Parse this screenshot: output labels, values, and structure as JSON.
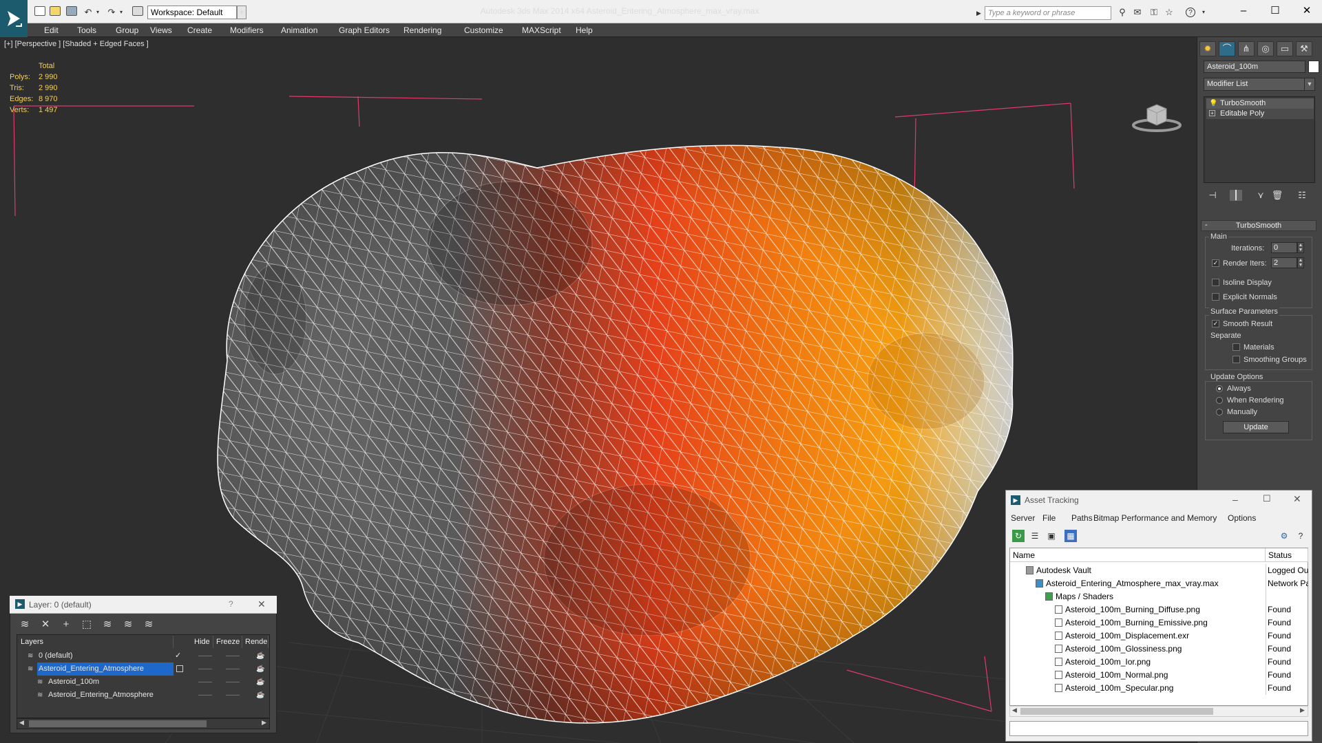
{
  "app": {
    "title": "Autodesk 3ds Max  2014 x64     Asteroid_Entering_Atmosphere_max_vray.max",
    "logo": "3ds-max-logo",
    "workspace_label": "Workspace: Default",
    "search_placeholder": "Type a keyword or phrase"
  },
  "menu": [
    "Edit",
    "Tools",
    "Group",
    "Views",
    "Create",
    "Modifiers",
    "Animation",
    "Graph Editors",
    "Rendering",
    "Customize",
    "MAXScript",
    "Help"
  ],
  "viewport": {
    "label": "[+] [Perspective ] [Shaded + Edged Faces ]",
    "stats": {
      "header": "Total",
      "rows": [
        {
          "label": "Polys:",
          "value": "2 990"
        },
        {
          "label": "Tris:",
          "value": "2 990"
        },
        {
          "label": "Edges:",
          "value": "8 970"
        },
        {
          "label": "Verts:",
          "value": "1 497"
        }
      ]
    },
    "colors": {
      "background": "#2e2e2e",
      "grid": "#3a3a3a",
      "bbox": "#e23a6b",
      "wire": "#ffffff"
    }
  },
  "command_panel": {
    "object_name": "Asteroid_100m",
    "modifier_list": "Modifier List",
    "stack": [
      "TurboSmooth",
      "Editable Poly"
    ],
    "rollout_title": "TurboSmooth",
    "main": {
      "title": "Main",
      "iterations_label": "Iterations:",
      "iterations_value": "0",
      "render_iters_label": "Render Iters:",
      "render_iters_value": "2",
      "render_iters_checked": true,
      "isoline_label": "Isoline Display",
      "explicit_label": "Explicit Normals"
    },
    "surface": {
      "title": "Surface Parameters",
      "smooth_label": "Smooth Result",
      "smooth_checked": true,
      "separate_label": "Separate",
      "materials_label": "Materials",
      "smoothing_label": "Smoothing Groups"
    },
    "update": {
      "title": "Update Options",
      "always": "Always",
      "when_rendering": "When Rendering",
      "manually": "Manually",
      "button": "Update"
    }
  },
  "layer_window": {
    "title": "Layer: 0 (default)",
    "help": "?",
    "close": "✕",
    "columns": [
      "Layers",
      "Hide",
      "Freeze",
      "Rende"
    ],
    "rows": [
      {
        "name": "0 (default)",
        "indent": 1,
        "selected": false,
        "active": true
      },
      {
        "name": "Asteroid_Entering_Atmosphere",
        "indent": 1,
        "selected": true,
        "active": false
      },
      {
        "name": "Asteroid_100m",
        "indent": 2,
        "selected": false,
        "active": false
      },
      {
        "name": "Asteroid_Entering_Atmosphere",
        "indent": 2,
        "selected": false,
        "active": false
      }
    ]
  },
  "asset_tracking": {
    "title": "Asset Tracking",
    "menus": [
      "Server",
      "File",
      "Paths",
      "Bitmap Performance and Memory",
      "Options"
    ],
    "columns": [
      "Name",
      "Status"
    ],
    "rows": [
      {
        "name": "Autodesk Vault",
        "status": "Logged Out",
        "indent": 1
      },
      {
        "name": "Asteroid_Entering_Atmosphere_max_vray.max",
        "status": "Network Pa",
        "indent": 2
      },
      {
        "name": "Maps / Shaders",
        "status": "",
        "indent": 3
      },
      {
        "name": "Asteroid_100m_Burning_Diffuse.png",
        "status": "Found",
        "indent": 4
      },
      {
        "name": "Asteroid_100m_Burning_Emissive.png",
        "status": "Found",
        "indent": 4
      },
      {
        "name": "Asteroid_100m_Displacement.exr",
        "status": "Found",
        "indent": 4
      },
      {
        "name": "Asteroid_100m_Glossiness.png",
        "status": "Found",
        "indent": 4
      },
      {
        "name": "Asteroid_100m_Ior.png",
        "status": "Found",
        "indent": 4
      },
      {
        "name": "Asteroid_100m_Normal.png",
        "status": "Found",
        "indent": 4
      },
      {
        "name": "Asteroid_100m_Specular.png",
        "status": "Found",
        "indent": 4
      }
    ]
  }
}
